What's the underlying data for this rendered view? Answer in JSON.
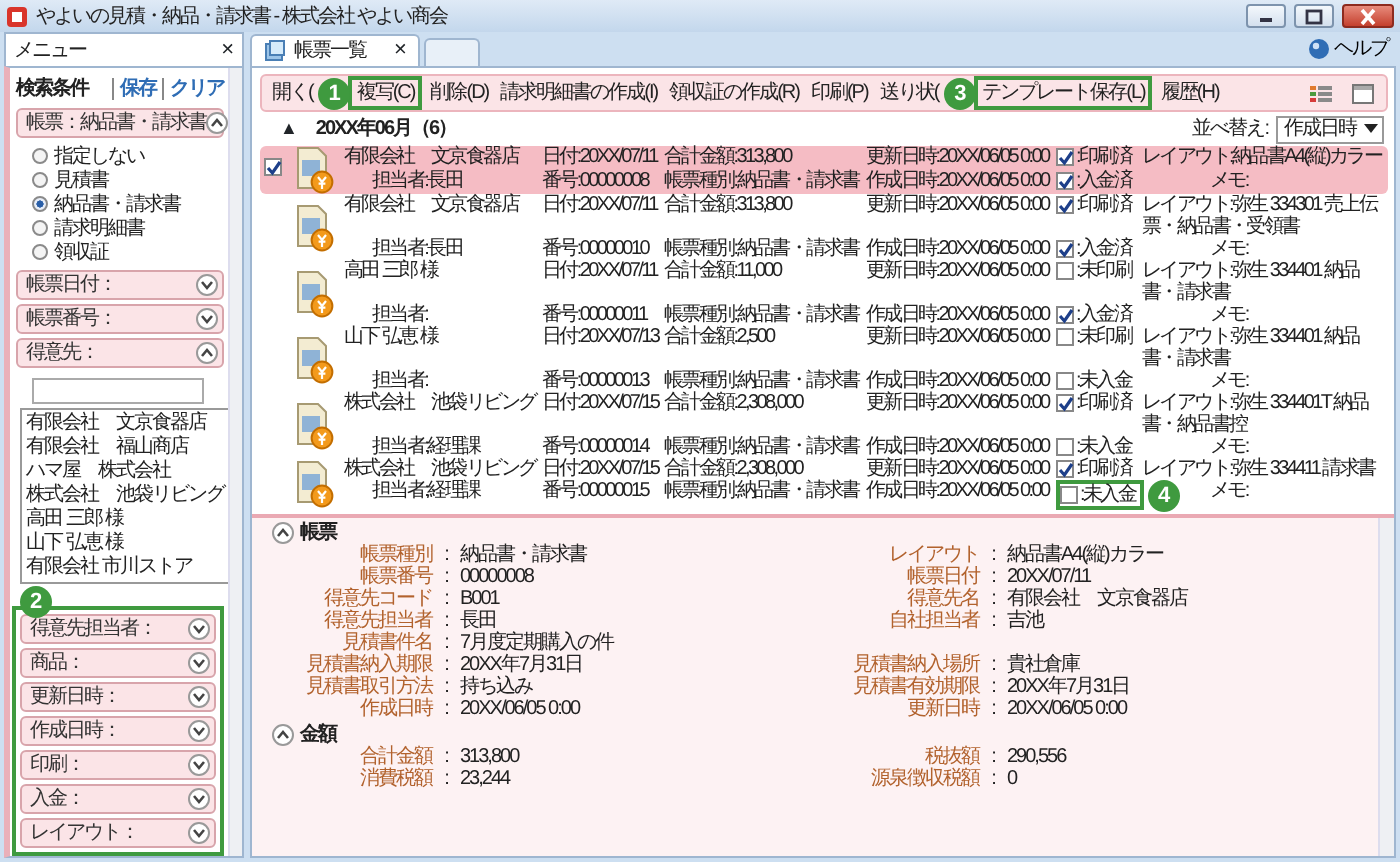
{
  "window": {
    "title": "やよいの見積・納品・請求書 - 株式会社 やよい商会"
  },
  "menu_tab": {
    "label": "メニュー",
    "close": "×"
  },
  "search": {
    "title": "検索条件",
    "save": "保存",
    "clear": "クリア",
    "groups": [
      {
        "filters": [
          {
            "label": "帳票：納品書・請求書",
            "expanded": true,
            "kind": "radio",
            "options": [
              {
                "label": "指定しない",
                "selected": false
              },
              {
                "label": "見積書",
                "selected": false
              },
              {
                "label": "納品書・請求書",
                "selected": true
              },
              {
                "label": "請求明細書",
                "selected": false
              },
              {
                "label": "領収証",
                "selected": false
              }
            ]
          },
          {
            "label": "帳票日付：",
            "expanded": false
          },
          {
            "label": "帳票番号：",
            "expanded": false
          },
          {
            "label": "得意先：",
            "expanded": true,
            "kind": "customers",
            "customers": [
              "有限会社　文京食器店",
              "有限会社　福山商店",
              "ハマ屋　株式会社",
              "株式会社　池袋リビング",
              "高田 三郎 様",
              "山下 弘恵 様",
              "有限会社 市川ストア"
            ]
          }
        ]
      },
      {
        "callout": "2",
        "filters": [
          {
            "label": "得意先担当者：",
            "expanded": false
          },
          {
            "label": "商品：",
            "expanded": false
          },
          {
            "label": "更新日時：",
            "expanded": false
          },
          {
            "label": "作成日時：",
            "expanded": false
          },
          {
            "label": "印刷：",
            "expanded": false
          },
          {
            "label": "入金：",
            "expanded": false
          },
          {
            "label": "レイアウト：",
            "expanded": false
          }
        ]
      }
    ]
  },
  "tabs": [
    {
      "label": "帳票一覧",
      "close": "×",
      "selected": true
    }
  ],
  "help": "ヘルプ",
  "toolbar": [
    {
      "label": "開く("
    },
    {
      "label": "複写(C)",
      "callout": "1"
    },
    {
      "label": "削除(D)"
    },
    {
      "label": "請求明細書の作成(I)"
    },
    {
      "label": "領収証の作成(R)"
    },
    {
      "label": "印刷(P)"
    },
    {
      "label": "送り状("
    },
    {
      "label": "テンプレート保存(L)",
      "callout": "3"
    },
    {
      "label": "履歴(H)"
    }
  ],
  "group": {
    "toggle": "▲",
    "title": "20XX年06月（6）"
  },
  "sort": {
    "label": "並べ替え:",
    "value": "作成日時"
  },
  "documents": [
    {
      "selected": true,
      "name": "有限会社　文京食器店",
      "person": "担当者:長田",
      "date": "日付:20XX/07/11",
      "number": "番号:00000008",
      "total": "合計金額:313,800",
      "type": "帳票種別:納品書・請求書",
      "updated": "更新日時:20XX/06/05 0:00",
      "created": "作成日時:20XX/06/05 0:00",
      "printed": true,
      "print_status": ":印刷済",
      "paid": true,
      "payment_status": ":入金済",
      "layout": "レイアウト:納品書A4(縦)カラー",
      "memo": "メモ:"
    },
    {
      "selected": false,
      "name": "有限会社　文京食器店",
      "person": "担当者:長田",
      "date": "日付:20XX/07/11",
      "number": "番号:00000010",
      "total": "合計金額:313,800",
      "type": "帳票種別:納品書・請求書",
      "updated": "更新日時:20XX/06/05 0:00",
      "created": "作成日時:20XX/06/05 0:00",
      "printed": true,
      "print_status": ":印刷済",
      "paid": true,
      "payment_status": ":入金済",
      "layout": "レイアウト:弥生 334301 売上伝票・納品書・受領書",
      "memo": "メモ:"
    },
    {
      "selected": false,
      "name": "高田 三郎 様",
      "person": "担当者:",
      "date": "日付:20XX/07/11",
      "number": "番号:00000011",
      "total": "合計金額:11,000",
      "type": "帳票種別:納品書・請求書",
      "updated": "更新日時:20XX/06/05 0:00",
      "created": "作成日時:20XX/06/05 0:00",
      "printed": false,
      "print_status": ":未印刷",
      "paid": true,
      "payment_status": ":入金済",
      "layout": "レイアウト:弥生 334401 納品書・請求書",
      "memo": "メモ:"
    },
    {
      "selected": false,
      "name": "山下 弘恵 様",
      "person": "担当者:",
      "date": "日付:20XX/07/13",
      "number": "番号:00000013",
      "total": "合計金額:2,500",
      "type": "帳票種別:納品書・請求書",
      "updated": "更新日時:20XX/06/05 0:00",
      "created": "作成日時:20XX/06/05 0:00",
      "printed": false,
      "print_status": ":未印刷",
      "paid": false,
      "payment_status": ":未入金",
      "layout": "レイアウト:弥生 334401 納品書・請求書",
      "memo": "メモ:"
    },
    {
      "selected": false,
      "name": "株式会社　池袋リビング",
      "person": "担当者:経理課",
      "date": "日付:20XX/07/15",
      "number": "番号:00000014",
      "total": "合計金額:2,308,000",
      "type": "帳票種別:納品書・請求書",
      "updated": "更新日時:20XX/06/05 0:00",
      "created": "作成日時:20XX/06/05 0:00",
      "printed": true,
      "print_status": ":印刷済",
      "paid": false,
      "payment_status": ":未入金",
      "layout": "レイアウト:弥生 334401T 納品書・納品書控",
      "memo": "メモ:"
    },
    {
      "selected": false,
      "name": "株式会社　池袋リビング",
      "person": "担当者:経理課",
      "date": "日付:20XX/07/15",
      "number": "番号:00000015",
      "total": "合計金額:2,308,000",
      "type": "帳票種別:納品書・請求書",
      "updated": "更新日時:20XX/06/05 0:00",
      "created": "作成日時:20XX/06/05 0:00",
      "printed": true,
      "print_status": ":印刷済",
      "paid": false,
      "payment_status": ":未入金",
      "payment_callout": "4",
      "layout": "レイアウト:弥生 334411 請求書",
      "memo": "メモ:"
    }
  ],
  "details": {
    "sections": [
      {
        "title": "帳票",
        "expanded": true,
        "rows": [
          [
            {
              "label": "帳票種別",
              "sep": ":",
              "value": "納品書・請求書"
            },
            {
              "label": "レイアウト",
              "sep": ":",
              "value": "納品書A4(縦)カラー"
            }
          ],
          [
            {
              "label": "帳票番号",
              "sep": ":",
              "value": "00000008"
            },
            {
              "label": "帳票日付",
              "sep": ":",
              "value": "20XX/07/11"
            }
          ],
          [
            {
              "label": "得意先コード",
              "sep": ":",
              "value": "B001"
            },
            {
              "label": "得意先名",
              "sep": ":",
              "value": "有限会社　文京食器店"
            }
          ],
          [
            {
              "label": "得意先担当者",
              "sep": ":",
              "value": "長田"
            },
            {
              "label": "自社担当者",
              "sep": ":",
              "value": "吉池"
            }
          ],
          [
            {
              "label": "見積書件名",
              "sep": ":",
              "value": "7月度定期購入の件"
            }
          ],
          [
            {
              "label": "見積書納入期限",
              "sep": ":",
              "value": "20XX年7月31日"
            },
            {
              "label": "見積書納入場所",
              "sep": ":",
              "value": "貴社倉庫"
            }
          ],
          [
            {
              "label": "見積書取引方法",
              "sep": ":",
              "value": "持ち込み"
            },
            {
              "label": "見積書有効期限",
              "sep": ":",
              "value": "20XX年7月31日"
            }
          ],
          [
            {
              "label": "作成日時",
              "sep": ":",
              "value": "20XX/06/05 0:00"
            },
            {
              "label": "更新日時",
              "sep": ":",
              "value": "20XX/06/05 0:00"
            }
          ]
        ]
      },
      {
        "title": "金額",
        "expanded": true,
        "rows": [
          [
            {
              "label": "合計金額",
              "sep": ":",
              "value": "313,800"
            },
            {
              "label": "税抜額",
              "sep": ":",
              "value": "290,556"
            }
          ],
          [
            {
              "label": "消費税額",
              "sep": ":",
              "value": "23,244"
            },
            {
              "label": "源泉徴収税額",
              "sep": ":",
              "value": "0"
            }
          ]
        ]
      }
    ]
  }
}
